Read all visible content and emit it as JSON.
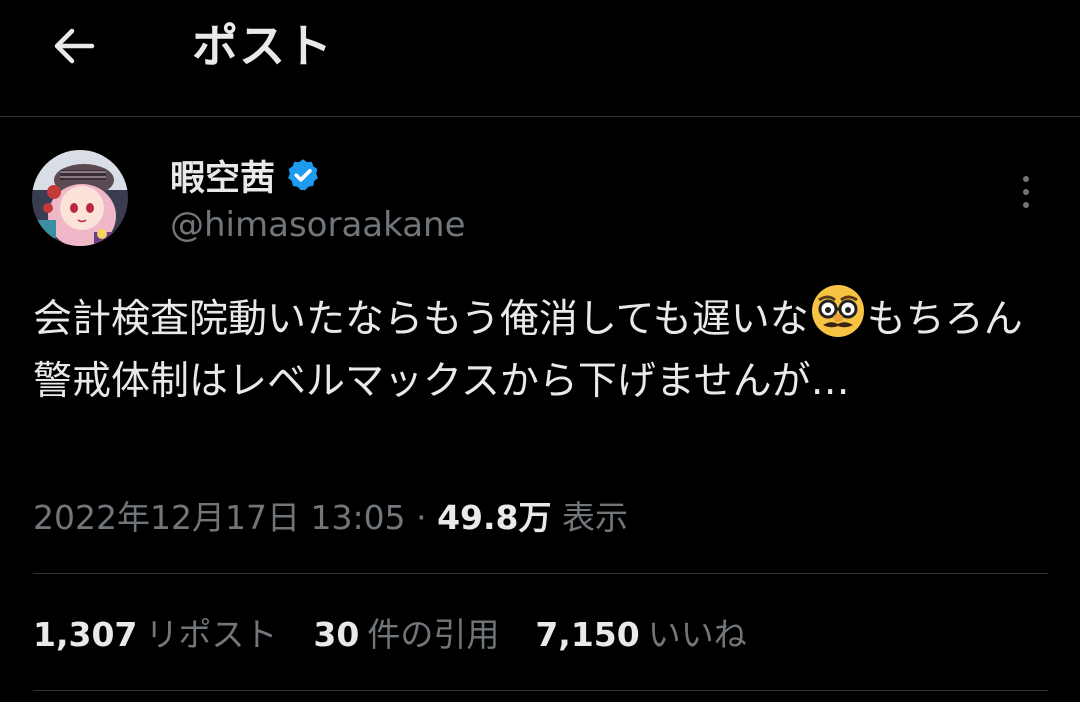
{
  "header": {
    "title": "ポスト"
  },
  "author": {
    "display_name": "暇空茜",
    "handle": "@himasoraakane"
  },
  "tweet": {
    "text_part1": "会計検査院動いたならもう俺消しても遅いな",
    "emoji": "disguised-face",
    "text_part2": "もちろん警戒体制はレベルマックスから下げませんが…"
  },
  "meta": {
    "timestamp": "2022年12月17日 13:05",
    "separator": "·",
    "views_count": "49.8万",
    "views_label": "表示"
  },
  "stats": {
    "reposts_count": "1,307",
    "reposts_label": "リポスト",
    "quotes_count": "30",
    "quotes_label": "件の引用",
    "likes_count": "7,150",
    "likes_label": "いいね"
  },
  "colors": {
    "background": "#000000",
    "primary_text": "#e7e9ea",
    "secondary_text": "#71767b",
    "verified_badge": "#1d9bf0",
    "divider": "#2f3336"
  }
}
